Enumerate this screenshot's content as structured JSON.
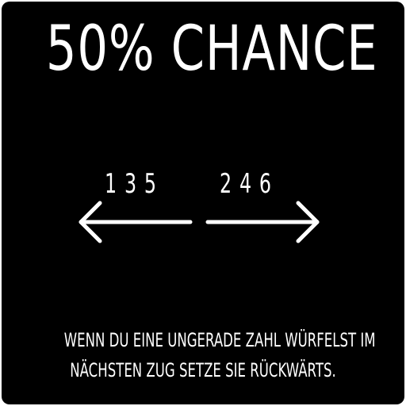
{
  "card": {
    "title": "50% CHANCE",
    "odd_numbers": "135",
    "even_numbers": "246",
    "message": {
      "line1": "WENN DU EINE UNGERADE ZAHL WÜRFELST IM",
      "line2": "NÄCHSTEN ZUG SETZE SIE  RÜCKWÄRTS."
    }
  },
  "colors": {
    "background": "#000000",
    "text": "#ffffff"
  },
  "icons": {
    "left": "arrow-left-icon",
    "right": "arrow-right-icon"
  }
}
